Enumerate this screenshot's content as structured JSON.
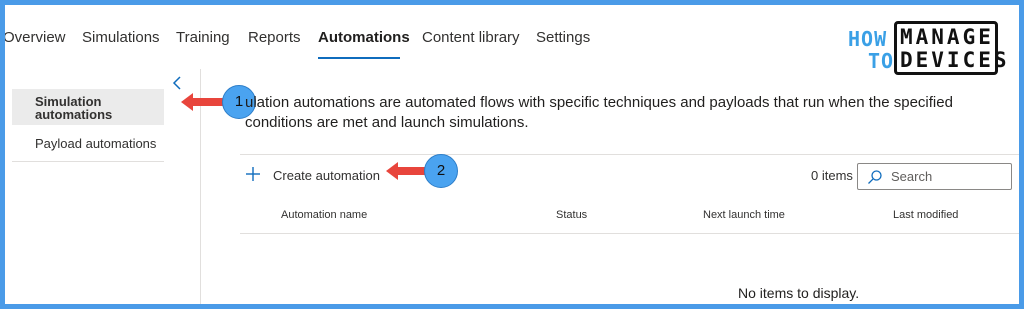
{
  "nav": {
    "tabs": [
      {
        "label": "Overview"
      },
      {
        "label": "Simulations"
      },
      {
        "label": "Training"
      },
      {
        "label": "Reports"
      },
      {
        "label": "Automations"
      },
      {
        "label": "Content library"
      },
      {
        "label": "Settings"
      }
    ],
    "active_tab": "Automations"
  },
  "logo": {
    "how": "HOW",
    "to": "TO",
    "manage": "MANAGE",
    "devices": "DEVICES"
  },
  "sidebar": {
    "items": [
      {
        "label": "Simulation automations",
        "active": true
      },
      {
        "label": "Payload automations",
        "active": false
      }
    ]
  },
  "annotations": [
    {
      "number": "1"
    },
    {
      "number": "2"
    }
  ],
  "main": {
    "description": "ulation automations are automated flows with specific techniques and payloads that run when the specified conditions are met and launch simulations.",
    "create_label": "Create automation",
    "items_count": "0 items",
    "search_placeholder": "Search",
    "columns": [
      "Automation name",
      "Status",
      "Next launch time",
      "Last modified"
    ],
    "empty_message": "No items to display."
  },
  "colors": {
    "accent": "#0f6cbd",
    "frame": "#4a9be8",
    "annotation_arrow": "#e8453c",
    "badge": "#4aa3f0"
  },
  "icons": [
    "chevron-left-icon",
    "plus-icon",
    "search-icon",
    "arrow-left-icon"
  ]
}
